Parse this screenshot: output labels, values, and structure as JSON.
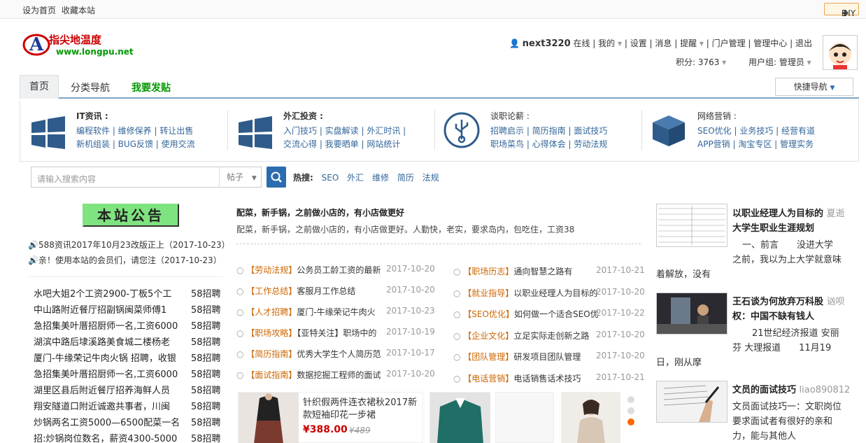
{
  "topbar": {
    "set_home": "设为首页",
    "favorite": "收藏本站",
    "diy": "DIY"
  },
  "logo": {
    "name": "指尖地温度",
    "url": "www.longpu.net"
  },
  "user": {
    "name": "next3220",
    "status": "在线",
    "mine": "我的",
    "settings": "设置",
    "messages": "消息",
    "remind": "提醒",
    "portal": "门户管理",
    "admin": "管理中心",
    "logout": "退出",
    "points": "积分: 3763",
    "group": "用户组: 管理员"
  },
  "nav": {
    "home": "首页",
    "category": "分类导航",
    "post": "我要发贴",
    "quick": "快捷导航"
  },
  "categories": [
    {
      "title": "IT资讯 :",
      "line1": "编程软件 | 维修保养 | 转让出售",
      "line2": "新机组装 | BUG反馈 | 使用交流"
    },
    {
      "title": "外汇投资 :",
      "line1": "入门技巧 | 实盘解读 | 外汇时讯 |",
      "line2": "交流心得 | 我要晒单 | 网站统计"
    },
    {
      "title": "谈职论薪 :",
      "line1": "招聘启示 | 简历指南 | 面试技巧",
      "line2": "职场菜鸟 | 心得体会 | 劳动法规"
    },
    {
      "title": "网络营销 :",
      "line1": "SEO优化 | 业务技巧 | 经营有道",
      "line2": "APP营销 | 淘宝专区 | 管理实务"
    }
  ],
  "search": {
    "placeholder": "请输入搜索内容",
    "scope": "帖子",
    "hot_label": "热搜:",
    "hot": [
      "SEO",
      "外汇",
      "维修",
      "简历",
      "法规"
    ]
  },
  "notice": {
    "title": "本站公告",
    "items": [
      "588资讯2017年10月23改版正上（2017-10-23）",
      "亲！使用本站的会员们，请您注（2017-10-23）"
    ]
  },
  "jobs": [
    {
      "t": "水吧大姐2个工资2900-丁板5个工",
      "s": "58招聘"
    },
    {
      "t": "中山路附近餐厅招副锅闽菜师傅1",
      "s": "58招聘"
    },
    {
      "t": "急招集美叶厝招厨师一名,工资6000",
      "s": "58招聘"
    },
    {
      "t": "湖滨中路后埭溪路美食城二楼杨老",
      "s": "58招聘"
    },
    {
      "t": "厦门-牛缘荣记牛肉火锅 招聘，收银",
      "s": "58招聘"
    },
    {
      "t": "急招集美叶厝招厨师一名,工资6000",
      "s": "58招聘"
    },
    {
      "t": "湖里区县后附近餐厅招养海鲜人员",
      "s": "58招聘"
    },
    {
      "t": "翔安隧道口附近诚邀共事者，川闽",
      "s": "58招聘"
    },
    {
      "t": "炒锅两名工资5000—6500配菜一名",
      "s": "58招聘"
    },
    {
      "t": "招:炒锅岗位数名，薪资4300-5000",
      "s": "58招聘"
    }
  ],
  "feature": {
    "title": "配菜，新手锅，之前做小店的，有小店做更好",
    "summary": "配菜，新手锅，之前做小店的，有小店做更好。人勤快，老实，要求岛内，包吃住，工资38"
  },
  "news_left": [
    {
      "cat": "劳动法规",
      "t": "公务员工龄工资的最新",
      "d": "2017-10-20"
    },
    {
      "cat": "工作总结",
      "t": "客服月工作总结",
      "d": "2017-10-20"
    },
    {
      "cat": "人才招聘",
      "t": "厦门-牛缘荣记牛肉火",
      "d": "2017-10-23"
    },
    {
      "cat": "职场攻略",
      "t": "【亚特关注】职场中的",
      "d": "2017-10-19"
    },
    {
      "cat": "简历指南",
      "t": "优秀大学生个人简历范",
      "d": "2017-10-17"
    },
    {
      "cat": "面试指南",
      "t": "数据挖掘工程师的面试",
      "d": "2017-10-20"
    }
  ],
  "news_right": [
    {
      "cat": "职场历志",
      "t": "通向智慧之路有",
      "d": "2017-10-21"
    },
    {
      "cat": "就业指导",
      "t": "以职业经理人为目标的",
      "d": "2017-10-20"
    },
    {
      "cat": "SEO优化",
      "t": "如何做一个适合SEO优",
      "d": "2017-10-22"
    },
    {
      "cat": "企业文化",
      "t": "立足实际走创新之路",
      "d": "2017-10-20"
    },
    {
      "cat": "团队管理",
      "t": "研发项目团队管理",
      "d": "2017-10-20"
    },
    {
      "cat": "电话营销",
      "t": "电话销售话术技巧",
      "d": "2017-10-21"
    }
  ],
  "product": {
    "title": "针织假两件连衣裙秋2017新款短袖印花一步裙",
    "price": "¥388.00",
    "old_price": "¥489"
  },
  "articles": [
    {
      "title": "以职业经理人为目标的",
      "author": "夏逝",
      "title2": "大学生职业生涯规划",
      "text1": "一、前言　　没进大学",
      "text2": "之前，我以为上大学就意味",
      "text3": "着解放，没有"
    },
    {
      "title": "王石谈为何放弃万科股",
      "author": "讻呗",
      "title2": "权：中国不缺有钱人",
      "text1": "21世纪经济报道 安丽",
      "text2": "芬 大理报道　　11月19",
      "text3": "日，刚从摩"
    },
    {
      "title": "文员的面试技巧",
      "author": "liao890812",
      "text1": "文员面试技巧一：文职岗位",
      "text2": "要求面试者有很好的亲和",
      "text3": "力，能与其他人"
    }
  ],
  "colors": {
    "accent": "#2b6cb0",
    "category_red": "#cc3300",
    "green": "#009900"
  }
}
